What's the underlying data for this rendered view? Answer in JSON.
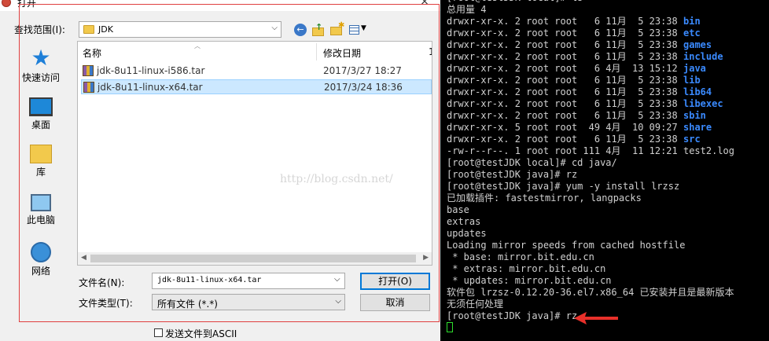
{
  "dialog": {
    "title": "打开",
    "lookin": {
      "label": "查找范围(I):",
      "value": "JDK"
    },
    "places": [
      {
        "label": "快速访问",
        "icon": "star-icon"
      },
      {
        "label": "桌面",
        "icon": "desktop-icon"
      },
      {
        "label": "库",
        "icon": "library-icon"
      },
      {
        "label": "此电脑",
        "icon": "computer-icon"
      },
      {
        "label": "网络",
        "icon": "network-icon"
      }
    ],
    "columns": {
      "name": "名称",
      "date": "修改日期",
      "extra": "1"
    },
    "files": [
      {
        "name": "jdk-8u11-linux-i586.tar",
        "date": "2017/3/27 18:27"
      },
      {
        "name": "jdk-8u11-linux-x64.tar",
        "date": "2017/3/24 18:36"
      }
    ],
    "filename": {
      "label": "文件名(N):",
      "value": "jdk-8u11-linux-x64.tar"
    },
    "filetype": {
      "label": "文件类型(T):",
      "value": "所有文件 (*.*)"
    },
    "open_label": "打开(O)",
    "cancel_label": "取消",
    "ascii_label": "发送文件到ASCII"
  },
  "terminal": {
    "lines": [
      {
        "text": "[root@testJDK local]# ls"
      },
      {
        "text": "总用量 4"
      },
      {
        "text": "drwxr-xr-x. 2 root root   6 11月  5 23:38 ",
        "dir": "bin"
      },
      {
        "text": "drwxr-xr-x. 2 root root   6 11月  5 23:38 ",
        "dir": "etc"
      },
      {
        "text": "drwxr-xr-x. 2 root root   6 11月  5 23:38 ",
        "dir": "games"
      },
      {
        "text": "drwxr-xr-x. 2 root root   6 11月  5 23:38 ",
        "dir": "include"
      },
      {
        "text": "drwxr-xr-x. 2 root root   6 4月  13 15:12 ",
        "dir": "java"
      },
      {
        "text": "drwxr-xr-x. 2 root root   6 11月  5 23:38 ",
        "dir": "lib"
      },
      {
        "text": "drwxr-xr-x. 2 root root   6 11月  5 23:38 ",
        "dir": "lib64"
      },
      {
        "text": "drwxr-xr-x. 2 root root   6 11月  5 23:38 ",
        "dir": "libexec"
      },
      {
        "text": "drwxr-xr-x. 2 root root   6 11月  5 23:38 ",
        "dir": "sbin"
      },
      {
        "text": "drwxr-xr-x. 5 root root  49 4月  10 09:27 ",
        "dir": "share"
      },
      {
        "text": "drwxr-xr-x. 2 root root   6 11月  5 23:38 ",
        "dir": "src"
      },
      {
        "text": "-rw-r--r--. 1 root root 111 4月  11 12:21 test2.log"
      },
      {
        "text": "[root@testJDK local]# cd java/"
      },
      {
        "text": "[root@testJDK java]# rz"
      },
      {
        "text": "[root@testJDK java]# yum -y install lrzsz"
      },
      {
        "text": "已加载插件: fastestmirror, langpacks"
      },
      {
        "text": "base"
      },
      {
        "text": "extras"
      },
      {
        "text": "updates"
      },
      {
        "text": "Loading mirror speeds from cached hostfile"
      },
      {
        "text": " * base: mirror.bit.edu.cn"
      },
      {
        "text": " * extras: mirror.bit.edu.cn"
      },
      {
        "text": " * updates: mirror.bit.edu.cn"
      },
      {
        "text": "软件包 lrzsz-0.12.20-36.el7.x86_64 已安装并且是最新版本"
      },
      {
        "text": "无须任何处理"
      },
      {
        "text": "[root@testJDK java]# rz"
      }
    ],
    "dir_color": "#3a8aff",
    "cursor_color": "#2ee02e"
  },
  "watermark": "http://blog.csdn.net/"
}
